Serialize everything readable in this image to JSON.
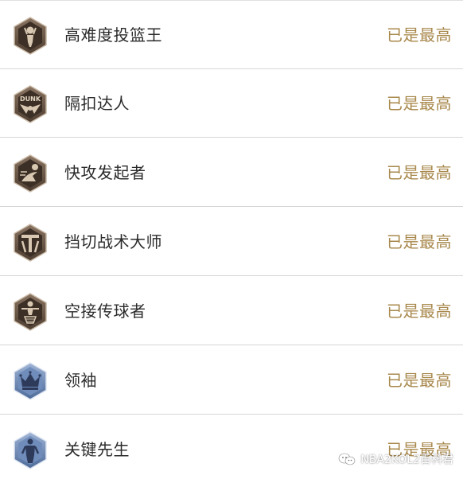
{
  "status_label": "已是最高",
  "status_color": "#a8884c",
  "badges": [
    {
      "label": "高难度投篮王",
      "icon": "tough-shot-badge-icon",
      "tier": "bronze"
    },
    {
      "label": "隔扣达人",
      "icon": "dunk-badge-icon",
      "tier": "bronze",
      "icon_text": "DUNK"
    },
    {
      "label": "快攻发起者",
      "icon": "fast-break-badge-icon",
      "tier": "bronze"
    },
    {
      "label": "挡切战术大师",
      "icon": "pick-and-roll-badge-icon",
      "tier": "bronze"
    },
    {
      "label": "空接传球者",
      "icon": "alley-oop-badge-icon",
      "tier": "bronze"
    },
    {
      "label": "领袖",
      "icon": "crown-badge-icon",
      "tier": "blue"
    },
    {
      "label": "关键先生",
      "icon": "clutch-player-badge-icon",
      "tier": "blue"
    }
  ],
  "watermark": {
    "text": "NBA2KOL2百科君"
  }
}
